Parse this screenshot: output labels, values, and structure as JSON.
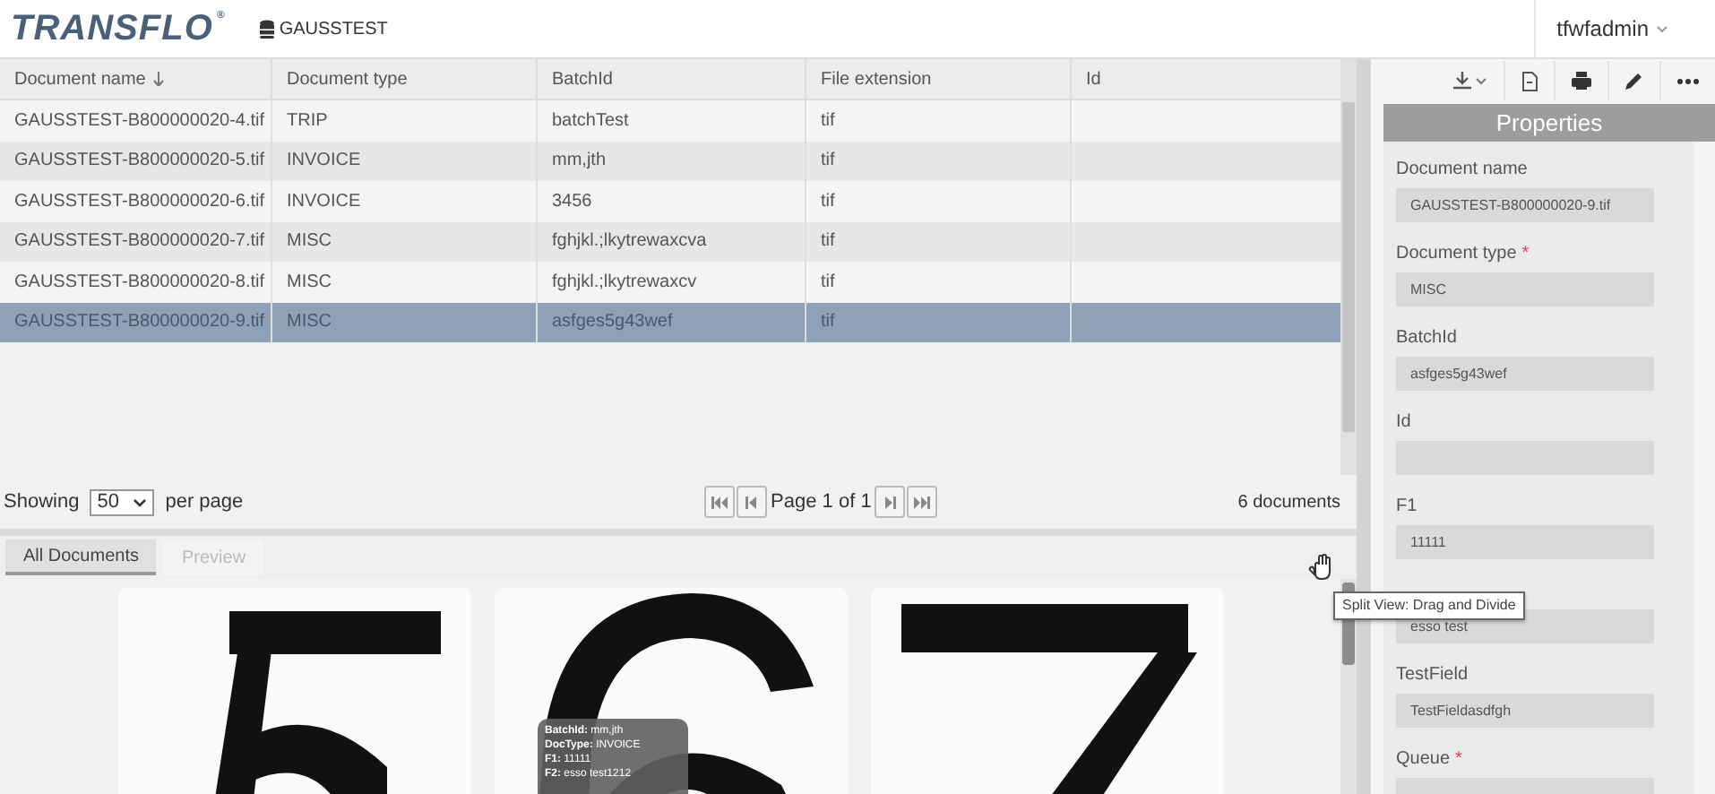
{
  "header": {
    "logo": "TRANSFLO$^{®}$",
    "database": "GAUSSTEST",
    "user": "tfwfadmin"
  },
  "table": {
    "columns": [
      {
        "label": "Document name",
        "sorted": true
      },
      {
        "label": "Document type",
        "sorted": false
      },
      {
        "label": "BatchId",
        "sorted": false
      },
      {
        "label": "File extension",
        "sorted": false
      },
      {
        "label": "Id",
        "sorted": false
      }
    ],
    "rows": [
      {
        "cells": [
          "GAUSSTEST-B800000020-4.tif",
          "TRIP",
          "batchTest",
          "tif",
          ""
        ],
        "selected": false
      },
      {
        "cells": [
          "GAUSSTEST-B800000020-5.tif",
          "INVOICE",
          "mm,jth",
          "tif",
          ""
        ],
        "selected": false
      },
      {
        "cells": [
          "GAUSSTEST-B800000020-6.tif",
          "INVOICE",
          "3456",
          "tif",
          ""
        ],
        "selected": false
      },
      {
        "cells": [
          "GAUSSTEST-B800000020-7.tif",
          "MISC",
          "fghjkl.;lkytrewaxcva",
          "tif",
          ""
        ],
        "selected": false
      },
      {
        "cells": [
          "GAUSSTEST-B800000020-8.tif",
          "MISC",
          "fghjkl.;lkytrewaxcv",
          "tif",
          ""
        ],
        "selected": false
      },
      {
        "cells": [
          "GAUSSTEST-B800000020-9.tif",
          "MISC",
          "asfges5g43wef",
          "tif",
          ""
        ],
        "selected": true
      }
    ]
  },
  "pagination": {
    "showing_label": "Showing",
    "page_size": "50",
    "per_page_label": "per page",
    "page_text": "Page 1 of 1",
    "total": "6 documents"
  },
  "tabs": [
    {
      "label": "All Documents",
      "selected": true
    },
    {
      "label": "Preview",
      "selected": false
    }
  ],
  "gallery": {
    "cards": [
      {
        "kind": "picture"
      },
      {
        "kind": "picture",
        "hover_info": [
          "**BatchId:** mm,jth",
          "**DocType:** INVOICE",
          "**F1:** 11111",
          "**F2:** esso test1212"
        ]
      },
      {
        "kind": "picture"
      }
    ]
  },
  "split_tooltip": "Split View: Drag and Divide",
  "properties": {
    "title": "Properties",
    "fields": [
      {
        "label": "Document name",
        "value": "GAUSSTEST-B800000020-9.tif"
      },
      {
        "label": "Document type",
        "required_mark": "*",
        "value": "MISC"
      },
      {
        "label": "BatchId",
        "value": "asfges5g43wef"
      },
      {
        "label": "Id"
      },
      {
        "label": "F1",
        "value": "11111"
      },
      {
        "value": "esso test"
      },
      {
        "label": "TestField",
        "value": "TestFieldasdfgh"
      },
      {
        "label": "Queue",
        "required_mark": "*"
      }
    ]
  }
}
